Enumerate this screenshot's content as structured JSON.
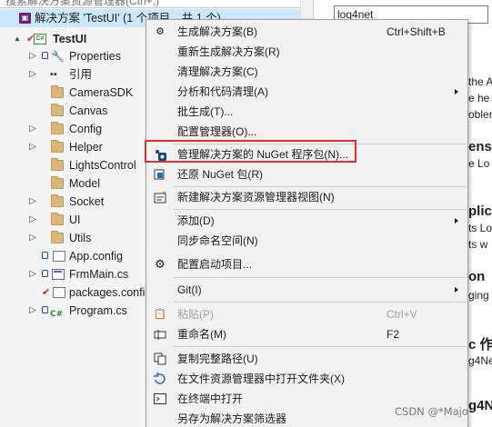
{
  "explorer": {
    "search_placeholder": "搜索解决方案资源管理器(Ctrl+;)",
    "solution_row": "解决方案 'TestUI' (1 个项目，共 1 个)",
    "items": [
      {
        "label": "TestUI",
        "kind": "project",
        "expander": "▲"
      },
      {
        "label": "Properties",
        "kind": "properties",
        "expander": "▷"
      },
      {
        "label": "引用",
        "kind": "references",
        "expander": "▷"
      },
      {
        "label": "CameraSDK",
        "kind": "folder",
        "expander": ""
      },
      {
        "label": "Canvas",
        "kind": "folder",
        "expander": ""
      },
      {
        "label": "Config",
        "kind": "folder",
        "expander": "▷"
      },
      {
        "label": "Helper",
        "kind": "folder",
        "expander": "▷"
      },
      {
        "label": "LightsControl",
        "kind": "folder",
        "expander": ""
      },
      {
        "label": "Model",
        "kind": "folder",
        "expander": ""
      },
      {
        "label": "Socket",
        "kind": "folder",
        "expander": "▷"
      },
      {
        "label": "UI",
        "kind": "folder",
        "expander": "▷"
      },
      {
        "label": "Utils",
        "kind": "folder",
        "expander": "▷"
      },
      {
        "label": "App.config",
        "kind": "config",
        "expander": ""
      },
      {
        "label": "FrmMain.cs",
        "kind": "form",
        "expander": "▷"
      },
      {
        "label": "packages.config",
        "kind": "packages",
        "expander": ""
      },
      {
        "label": "Program.cs",
        "kind": "csharp",
        "expander": "▷"
      }
    ]
  },
  "nuget": {
    "search_value": "log4net",
    "fragments": [
      "the Ap",
      "e he",
      "oblen",
      "ensi",
      "e Lo",
      "plica",
      "ts Lo",
      "ts w",
      "on",
      "ging",
      "c 作",
      "g4Ne",
      "g4N"
    ]
  },
  "menu": {
    "items": [
      {
        "label": "生成解决方案(B)",
        "shortcut": "Ctrl+Shift+B",
        "icon": "build-icon",
        "submenu": false,
        "disabled": false
      },
      {
        "label": "重新生成解决方案(R)",
        "shortcut": "",
        "icon": "",
        "submenu": false,
        "disabled": false
      },
      {
        "label": "清理解决方案(C)",
        "shortcut": "",
        "icon": "",
        "submenu": false,
        "disabled": false
      },
      {
        "label": "分析和代码清理(A)",
        "shortcut": "",
        "icon": "",
        "submenu": true,
        "disabled": false
      },
      {
        "label": "批生成(T)...",
        "shortcut": "",
        "icon": "",
        "submenu": false,
        "disabled": false
      },
      {
        "label": "配置管理器(O)...",
        "shortcut": "",
        "icon": "",
        "submenu": false,
        "disabled": false
      },
      {
        "label": "管理解决方案的 NuGet 程序包(N)...",
        "shortcut": "",
        "icon": "nuget-icon",
        "submenu": false,
        "disabled": false
      },
      {
        "label": "还原 NuGet 包(R)",
        "shortcut": "",
        "icon": "restore-icon",
        "submenu": false,
        "disabled": false
      },
      {
        "label": "新建解决方案资源管理器视图(N)",
        "shortcut": "",
        "icon": "new-view-icon",
        "submenu": false,
        "disabled": false
      },
      {
        "label": "添加(D)",
        "shortcut": "",
        "icon": "",
        "submenu": true,
        "disabled": false
      },
      {
        "label": "同步命名空间(N)",
        "shortcut": "",
        "icon": "",
        "submenu": false,
        "disabled": false
      },
      {
        "label": "配置启动项目...",
        "shortcut": "",
        "icon": "gear-icon",
        "submenu": false,
        "disabled": false
      },
      {
        "label": "Git(I)",
        "shortcut": "",
        "icon": "",
        "submenu": true,
        "disabled": false
      },
      {
        "label": "粘贴(P)",
        "shortcut": "Ctrl+V",
        "icon": "paste-icon",
        "submenu": false,
        "disabled": true
      },
      {
        "label": "重命名(M)",
        "shortcut": "F2",
        "icon": "rename-icon",
        "submenu": false,
        "disabled": false
      },
      {
        "label": "复制完整路径(U)",
        "shortcut": "",
        "icon": "copy-path-icon",
        "submenu": false,
        "disabled": false
      },
      {
        "label": "在文件资源管理器中打开文件夹(X)",
        "shortcut": "",
        "icon": "open-folder-icon",
        "submenu": false,
        "disabled": false
      },
      {
        "label": "在终端中打开",
        "shortcut": "",
        "icon": "terminal-icon",
        "submenu": false,
        "disabled": false
      },
      {
        "label": "另存为解决方案筛选器",
        "shortcut": "",
        "icon": "",
        "submenu": false,
        "disabled": false
      }
    ]
  },
  "watermark": "CSDN @*Majo",
  "colors": {
    "highlight_border": "#e0312f",
    "selection": "#cce8ff",
    "menu_bg": "#f2f2f2",
    "disabled_text": "#a2a2a2"
  }
}
